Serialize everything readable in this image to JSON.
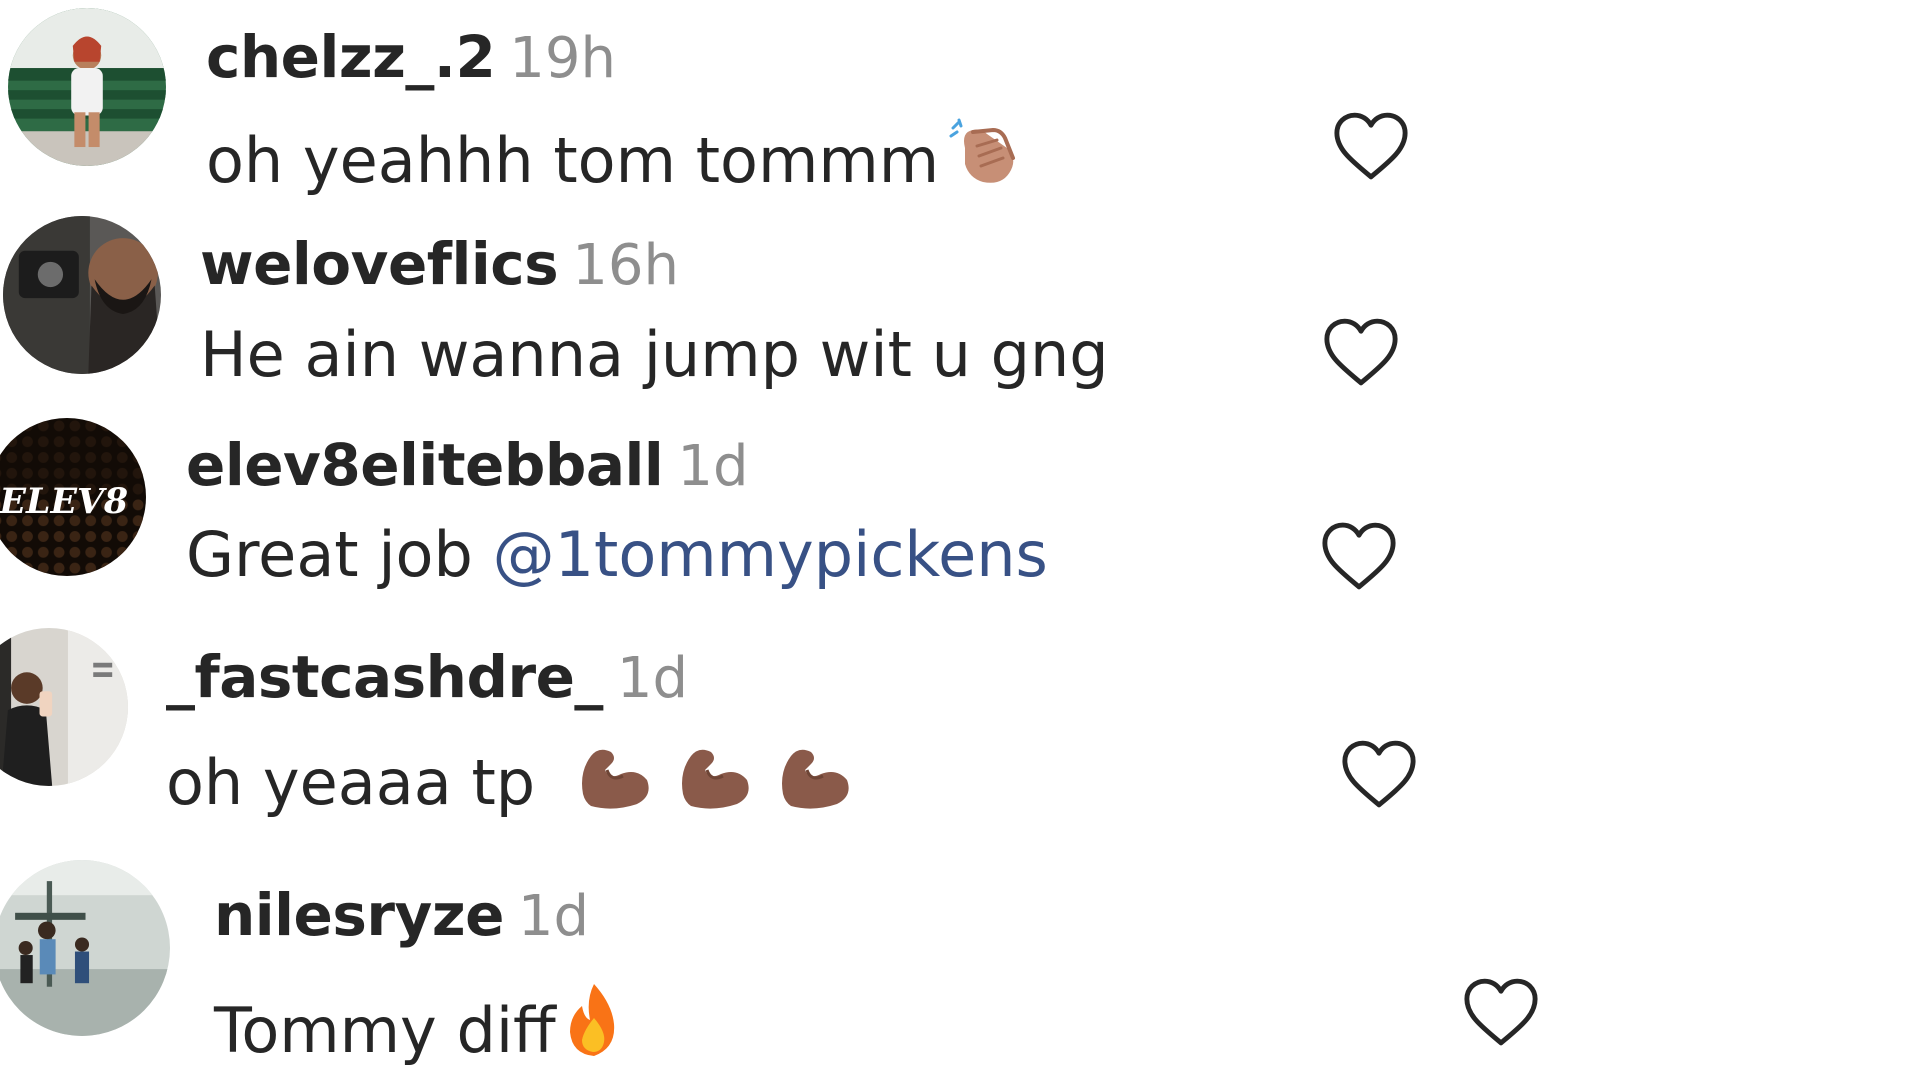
{
  "colors": {
    "text": "#262626",
    "meta": "#8e8e8e",
    "mention": "#385185",
    "background": "#ffffff"
  },
  "comments": [
    {
      "username": "chelzz_.2",
      "time": "19h",
      "text": "oh yeahhh tom tommm",
      "emoji": "clapping-hands-icon"
    },
    {
      "username": "weloveflics",
      "time": "16h",
      "text": "He ain wanna jump wit u gng"
    },
    {
      "username": "elev8elitebball",
      "time": "1d",
      "text": "Great job ",
      "mention": "@1tommypickens",
      "avatar_text": "ELEV8"
    },
    {
      "username": "_fastcashdre_",
      "time": "1d",
      "text": "oh yeaaa tp",
      "emoji": "flexed-biceps-icon"
    },
    {
      "username": "nilesryze",
      "time": "1d",
      "text": "Tommy diff",
      "emoji": "fire-icon"
    }
  ]
}
